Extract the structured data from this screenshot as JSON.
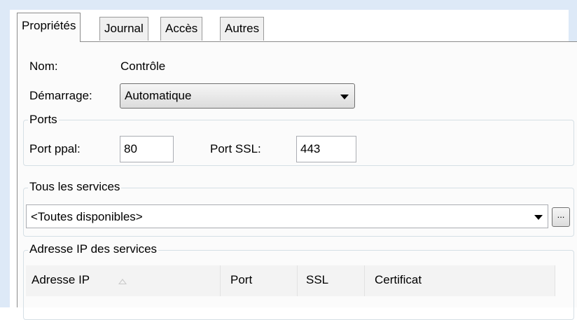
{
  "tabs": [
    {
      "label": "Propriétés",
      "active": true
    },
    {
      "label": "Journal",
      "active": false
    },
    {
      "label": "Accès",
      "active": false
    },
    {
      "label": "Autres",
      "active": false
    }
  ],
  "general": {
    "name_label": "Nom:",
    "name_value": "Contrôle",
    "startup_label": "Démarrage:",
    "startup_value": "Automatique"
  },
  "ports": {
    "title": "Ports",
    "main_port_label": "Port ppal:",
    "main_port_value": "80",
    "ssl_port_label": "Port SSL:",
    "ssl_port_value": "443"
  },
  "services": {
    "title": "Tous les services",
    "selected": "<Toutes disponibles>",
    "more_button": "..."
  },
  "ip_services": {
    "title": "Adresse IP des services",
    "columns": [
      "Adresse IP",
      "Port",
      "SSL",
      "Certificat"
    ]
  },
  "colors": {
    "panel_bg": "#fbfbfb",
    "window_frame": "#dde9f7",
    "group_border": "#d5dfe5"
  },
  "icons": {
    "dropdown": "chevron-down-icon",
    "sort": "sort-ascending-icon"
  }
}
